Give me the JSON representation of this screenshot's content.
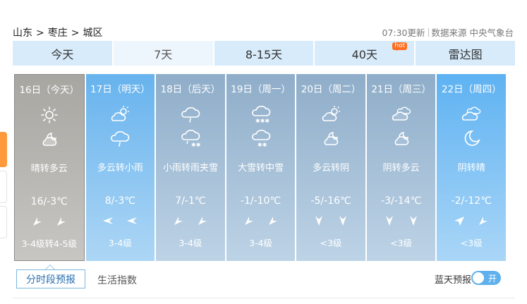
{
  "breadcrumb": {
    "province": "山东",
    "city": "枣庄",
    "district": "城区",
    "separator": ">"
  },
  "meta": {
    "update_time": "07:30更新",
    "source": "数据来源 中央气象台"
  },
  "tabs": [
    {
      "label": "今天"
    },
    {
      "label": "7天"
    },
    {
      "label": "8-15天"
    },
    {
      "label": "40天",
      "badge": "hot"
    },
    {
      "label": "雷达图"
    }
  ],
  "days": [
    {
      "date": "16日（今天）",
      "day_icon": "sun-icon",
      "night_icon": "partly-cloudy-night-icon",
      "condition": "晴转多云",
      "temp": "16/-3℃",
      "wind": "3-4级转4-5级"
    },
    {
      "date": "17日（明天）",
      "day_icon": "partly-cloudy-icon",
      "night_icon": "light-rain-icon",
      "condition": "多云转小雨",
      "temp": "8/-3℃",
      "wind": "3-4级"
    },
    {
      "date": "18日（后天）",
      "day_icon": "light-rain-icon",
      "night_icon": "sleet-icon",
      "condition": "小雨转雨夹雪",
      "temp": "7/-1℃",
      "wind": "3-4级"
    },
    {
      "date": "19日（周一）",
      "day_icon": "heavy-snow-icon",
      "night_icon": "moderate-snow-icon",
      "condition": "大雪转中雪",
      "temp": "-1/-10℃",
      "wind": "3-4级"
    },
    {
      "date": "20日（周二）",
      "day_icon": "partly-cloudy-icon",
      "night_icon": "partly-cloudy-night-icon",
      "condition": "多云转阴",
      "temp": "-5/-16℃",
      "wind": "<3级"
    },
    {
      "date": "21日（周三）",
      "day_icon": "overcast-icon",
      "night_icon": "partly-cloudy-night-icon",
      "condition": "阴转多云",
      "temp": "-3/-14℃",
      "wind": "<3级"
    },
    {
      "date": "22日（周四）",
      "day_icon": "overcast-icon",
      "night_icon": "moon-icon",
      "condition": "阴转晴",
      "temp": "-2/-12℃",
      "wind": "<3级"
    }
  ],
  "bottom": {
    "period_button": "分时段预报",
    "life_index": "生活指数",
    "blue_sky": "蓝天预报",
    "toggle_label": "开"
  },
  "colors": {
    "tab_bg": "#d7ebfb",
    "accent": "#5fb0ec",
    "hot_badge": "#ff6d1f"
  }
}
